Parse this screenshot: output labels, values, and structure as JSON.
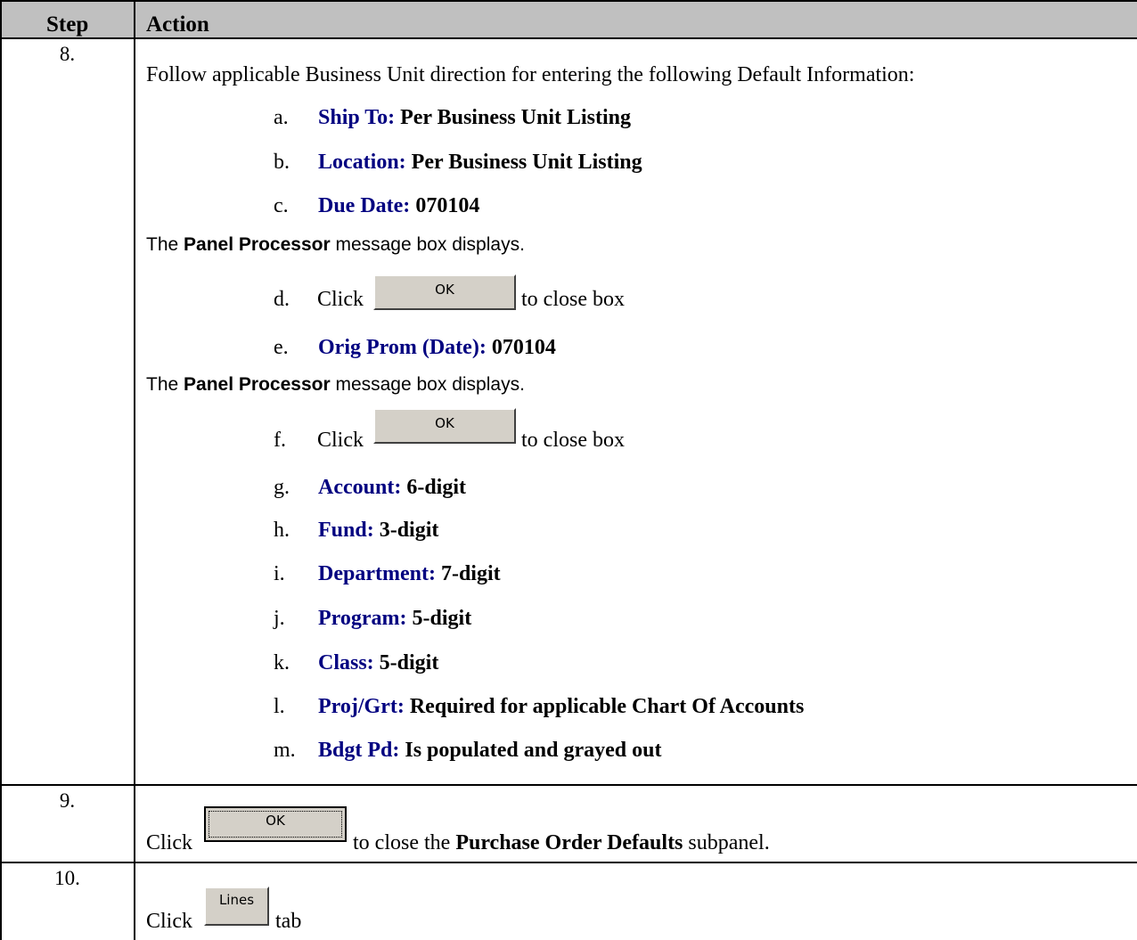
{
  "header": {
    "step": "Step",
    "action": "Action"
  },
  "rows": [
    {
      "step": "8.",
      "intro": "Follow applicable Business Unit direction for entering the following Default Information:",
      "items": [
        {
          "letter": "a.",
          "label": "Ship To:",
          "value": "Per Business Unit Listing"
        },
        {
          "letter": "b.",
          "label": "Location:",
          "value": "Per Business Unit Listing"
        },
        {
          "letter": "c.",
          "label": "Due Date:",
          "value": "070104"
        },
        {
          "letter": "e.",
          "label": "Orig Prom (Date):",
          "value": "070104"
        },
        {
          "letter": "g.",
          "label": "Account:",
          "value": "6-digit"
        },
        {
          "letter": "h.",
          "label": "Fund:",
          "value": "3-digit"
        },
        {
          "letter": "i.",
          "label": "Department:",
          "value": "7-digit"
        },
        {
          "letter": "j.",
          "label": "Program:",
          "value": "5-digit"
        },
        {
          "letter": "k.",
          "label": "Class:",
          "value": "5-digit"
        },
        {
          "letter": "l.",
          "label": "Proj/Grt:",
          "value": "Required for applicable Chart Of Accounts"
        },
        {
          "letter": "m.",
          "label": "Bdgt Pd:",
          "value": "Is populated and grayed out"
        }
      ],
      "notes": [
        {
          "pre": "The ",
          "bold": "Panel Processor",
          "post": " message box displays."
        },
        {
          "pre": "The ",
          "bold": "Panel Processor",
          "post": " message box displays."
        }
      ],
      "clicks": [
        {
          "letter": "d.",
          "click": "Click",
          "button": "OK",
          "after": "to close box"
        },
        {
          "letter": "f.",
          "click": "Click",
          "button": "OK",
          "after": "to close box"
        }
      ]
    },
    {
      "step": "9.",
      "click": "Click",
      "button": "OK",
      "after_pre": "to close the ",
      "after_bold": "Purchase Order Defaults",
      "after_post": " subpanel."
    },
    {
      "step": "10.",
      "click": "Click",
      "button": "Lines",
      "after": "tab"
    }
  ]
}
